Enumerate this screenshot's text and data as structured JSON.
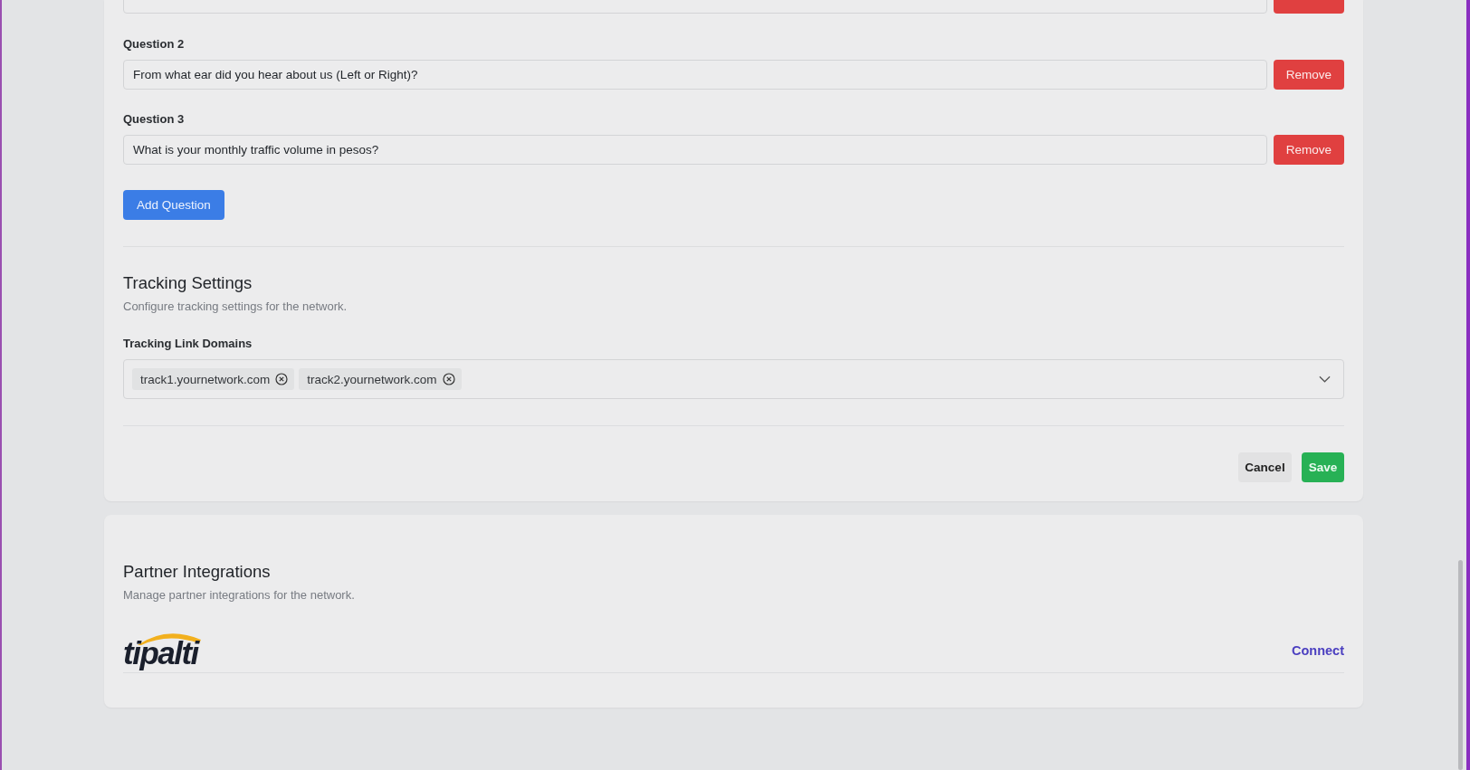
{
  "questions": [
    {
      "label": "Question 2",
      "value": "From what ear did you hear about us (Left or Right)?",
      "action": "Remove"
    },
    {
      "label": "Question 3",
      "value": "What is your monthly traffic volume in pesos?",
      "action": "Remove"
    }
  ],
  "add_button": "Add Question",
  "tracking": {
    "title": "Tracking Settings",
    "description": "Configure tracking settings for the network.",
    "field_label": "Tracking Link Domains",
    "domains": [
      "track1.yournetwork.com",
      "track2.yournetwork.com"
    ]
  },
  "actions": {
    "cancel": "Cancel",
    "save": "Save"
  },
  "partners": {
    "title": "Partner Integrations",
    "description": "Manage partner integrations for the network.",
    "items": [
      {
        "name": "tipalti",
        "action": "Connect"
      }
    ]
  }
}
